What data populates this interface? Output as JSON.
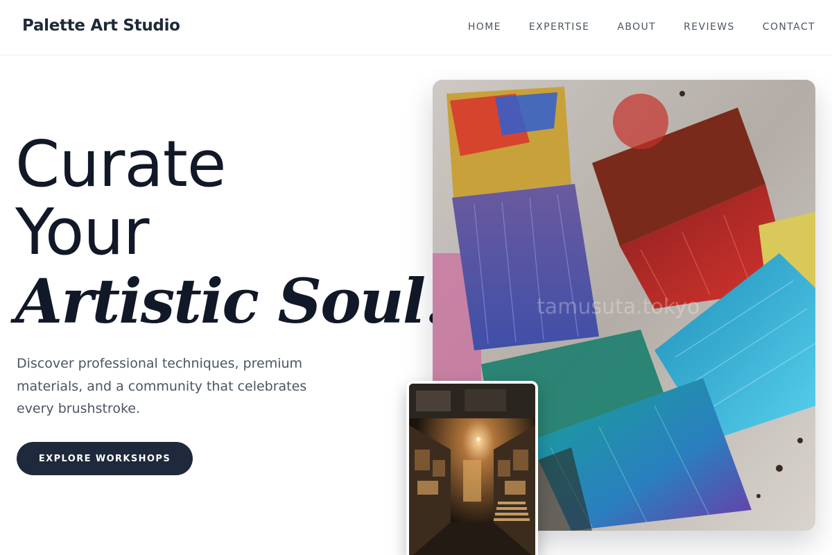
{
  "brand": {
    "name": "Palette Art Studio"
  },
  "nav": {
    "items": [
      {
        "label": "HOME"
      },
      {
        "label": "EXPERTISE"
      },
      {
        "label": "ABOUT"
      },
      {
        "label": "REVIEWS"
      },
      {
        "label": "CONTACT"
      }
    ]
  },
  "hero": {
    "headline_line1": "Curate",
    "headline_line2": "Your",
    "headline_italic": "Artistic Soul.",
    "description": "Discover professional techniques, premium materials, and a community that celebrates every brushstroke.",
    "cta_label": "EXPLORE WORKSHOPS"
  },
  "images": {
    "main_watermark": "tamusuta.tokyo"
  },
  "colors": {
    "accent_dark": "#1e293b",
    "heading": "#111827",
    "body_text": "#4b5563"
  }
}
